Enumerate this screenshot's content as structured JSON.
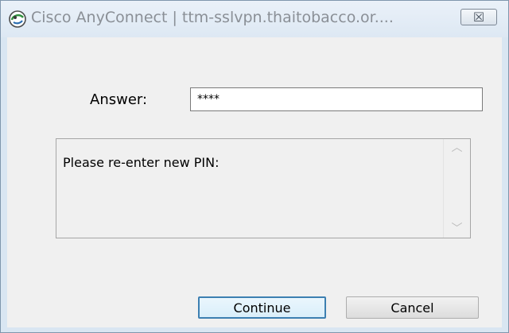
{
  "window": {
    "title": "Cisco AnyConnect | ttm-sslvpn.thaitobacco.or....",
    "close_glyph": "☒"
  },
  "form": {
    "answer_label": "Answer:",
    "answer_value": "****"
  },
  "message": {
    "text": "Please re-enter new PIN:"
  },
  "buttons": {
    "continue_label": "Continue",
    "cancel_label": "Cancel"
  },
  "icons": {
    "app": "cisco-anyconnect-icon",
    "close": "close-icon",
    "scroll_up": "scroll-up-arrow-icon",
    "scroll_down": "scroll-down-arrow-icon"
  },
  "colors": {
    "focus_border": "#3c7fb1",
    "title_text": "#8a8f96",
    "frame": "#d9e6f2"
  }
}
